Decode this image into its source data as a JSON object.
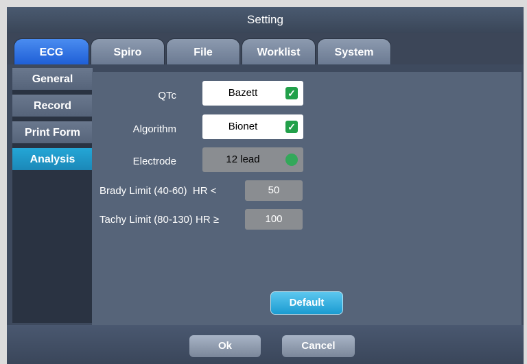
{
  "window": {
    "title": "Setting"
  },
  "tabs": [
    "ECG",
    "Spiro",
    "File",
    "Worklist",
    "System"
  ],
  "sidebar": {
    "items": [
      {
        "label": "General"
      },
      {
        "label": "Record"
      },
      {
        "label": "Print Form"
      },
      {
        "label": "Analysis"
      }
    ]
  },
  "form": {
    "qtc": {
      "label": "QTc",
      "value": "Bazett"
    },
    "algorithm": {
      "label": "Algorithm",
      "value": "Bionet"
    },
    "electrode": {
      "label": "Electrode",
      "value": "12 lead"
    },
    "brady": {
      "label": "Brady Limit (40-60)  HR <",
      "value": "50"
    },
    "tachy": {
      "label": "Tachy Limit (80-130) HR ≥",
      "value": "100"
    },
    "default_button": "Default"
  },
  "footer": {
    "ok": "Ok",
    "cancel": "Cancel"
  },
  "colors": {
    "accent_tab": "#1f5fd6",
    "accent_side": "#1b88b8",
    "check_green": "#22a04a",
    "default_button": "#1b9bd1"
  },
  "icons": {
    "check": "check-icon"
  }
}
